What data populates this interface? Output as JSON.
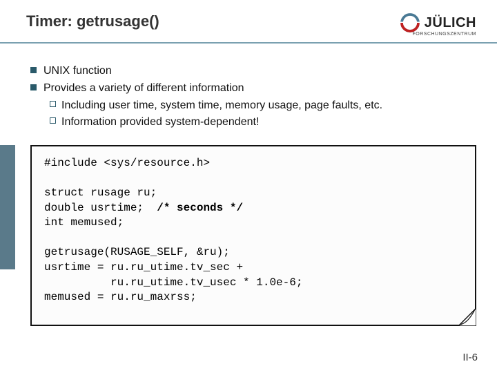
{
  "header": {
    "title": "Timer: getrusage()",
    "logo_text": "JÜLICH",
    "logo_sub": "FORSCHUNGSZENTRUM"
  },
  "bullets": {
    "b1a": "UNIX function",
    "b1b": "Provides a variety of different information",
    "b2a": "Including user time, system time, memory usage, page faults, etc.",
    "b2b": "Information provided system-dependent!"
  },
  "code": {
    "l1a": "#include <sys/resource.h>",
    "l3": "struct rusage ru;",
    "l4a": "double usrtime;  ",
    "l4b": "/* seconds */",
    "l5": "int memused;",
    "l7": "getrusage(RUSAGE_SELF, &ru);",
    "l8": "usrtime = ru.ru_utime.tv_sec +",
    "l9": "          ru.ru_utime.tv_usec * 1.0e-6;",
    "l10": "memused = ru.ru_maxrss;"
  },
  "footer": {
    "page": "II-6"
  }
}
